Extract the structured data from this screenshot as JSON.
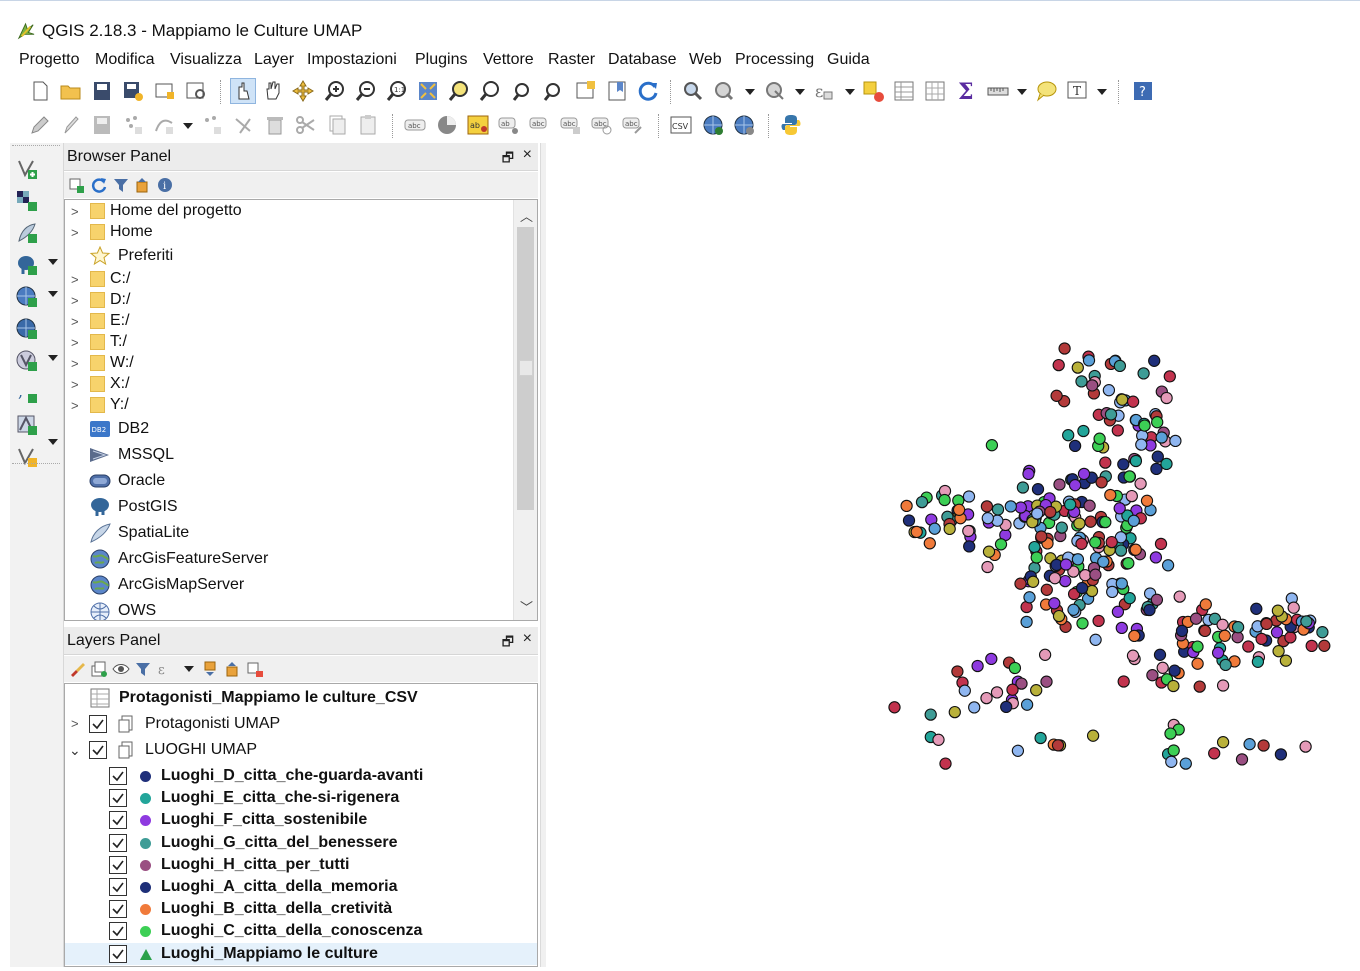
{
  "window": {
    "title": "QGIS 2.18.3 - Mappiamo le Culture UMAP"
  },
  "menu": [
    "Progetto",
    "Modifica",
    "Visualizza",
    "Layer",
    "Impostazioni",
    "Plugins",
    "Vettore",
    "Raster",
    "Database",
    "Web",
    "Processing",
    "Guida"
  ],
  "browser_panel": {
    "title": "Browser Panel",
    "float_glyph": "🗗",
    "close_glyph": "×",
    "items": [
      {
        "label": "Home del progetto",
        "icon": "folder-icon",
        "expandable": true
      },
      {
        "label": "Home",
        "icon": "folder-icon",
        "expandable": true
      },
      {
        "label": "Preferiti",
        "icon": "star-icon",
        "expandable": false
      },
      {
        "label": "C:/",
        "icon": "folder-icon",
        "expandable": true
      },
      {
        "label": "D:/",
        "icon": "folder-icon",
        "expandable": true
      },
      {
        "label": "E:/",
        "icon": "folder-icon",
        "expandable": true
      },
      {
        "label": "T:/",
        "icon": "folder-icon",
        "expandable": true
      },
      {
        "label": "W:/",
        "icon": "folder-icon",
        "expandable": true
      },
      {
        "label": "X:/",
        "icon": "folder-icon",
        "expandable": true
      },
      {
        "label": "Y:/",
        "icon": "folder-icon",
        "expandable": true
      },
      {
        "label": "DB2",
        "icon": "db2-icon",
        "expandable": false
      },
      {
        "label": "MSSQL",
        "icon": "mssql-icon",
        "expandable": false
      },
      {
        "label": "Oracle",
        "icon": "oracle-icon",
        "expandable": false
      },
      {
        "label": "PostGIS",
        "icon": "postgis-elephant-icon",
        "expandable": false
      },
      {
        "label": "SpatiaLite",
        "icon": "spatialite-feather-icon",
        "expandable": false
      },
      {
        "label": "ArcGisFeatureServer",
        "icon": "globe-icon",
        "expandable": false
      },
      {
        "label": "ArcGisMapServer",
        "icon": "globe-icon",
        "expandable": false
      },
      {
        "label": "OWS",
        "icon": "ows-globe-icon",
        "expandable": false
      }
    ],
    "db2_badge": "DB2"
  },
  "layers_panel": {
    "title": "Layers Panel",
    "float_glyph": "🗗",
    "close_glyph": "×",
    "csv_layer": "Protagonisti_Mappiamo le culture_CSV",
    "groups": [
      {
        "label": "Protagonisti UMAP",
        "expanded": false,
        "checked": true
      },
      {
        "label": "LUOGHI UMAP",
        "expanded": true,
        "checked": true
      }
    ],
    "layers": [
      {
        "label": "Luoghi_D_citta_che-guarda-avanti",
        "color": "#1f2f7a",
        "checked": true
      },
      {
        "label": "Luoghi_E_citta_che-si-rigenera",
        "color": "#22a59a",
        "checked": true
      },
      {
        "label": "Luoghi_F_citta_sostenibile",
        "color": "#8e3ae0",
        "checked": true
      },
      {
        "label": "Luoghi_G_citta_del_benessere",
        "color": "#3e9c96",
        "checked": true
      },
      {
        "label": "Luoghi_H_citta_per_tutti",
        "color": "#9a4f82",
        "checked": true
      },
      {
        "label": "Luoghi_A_citta_della_memoria",
        "color": "#1e2f78",
        "checked": true
      },
      {
        "label": "Luoghi_B_citta_della_cretività",
        "color": "#f07a3a",
        "checked": true
      },
      {
        "label": "Luoghi_C_citta_della_conoscenza",
        "color": "#3ccf55",
        "checked": true
      },
      {
        "label": "Luoghi_Mappiamo le culture",
        "color": "#2aa14b",
        "checked": true,
        "selected": true
      }
    ]
  },
  "map": {
    "palette": [
      "#1f2f7a",
      "#22a59a",
      "#8e3ae0",
      "#3e9c96",
      "#9a4f82",
      "#c2334e",
      "#f07a3a",
      "#3ccf55",
      "#8fb6f0",
      "#e59ab8",
      "#b9b13a",
      "#b33a3a",
      "#5aa0d8"
    ]
  },
  "icons": {
    "app": "qgis-logo-icon",
    "checkmark": "checkmark-icon"
  }
}
